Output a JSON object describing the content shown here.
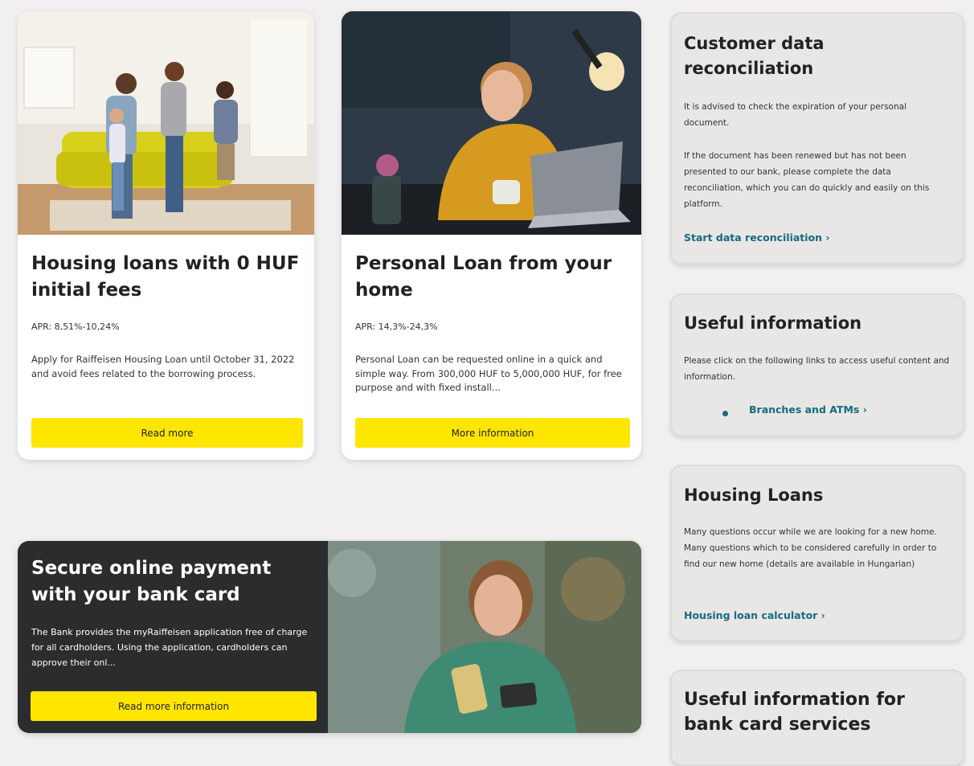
{
  "card_housing": {
    "title": "Housing loans with 0 HUF initial fees",
    "apr": "APR: 8,51%-10,24%",
    "description": "Apply for Raiffeisen Housing Loan until October 31, 2022 and avoid fees related to the borrowing process.",
    "button": "Read more",
    "image_icon": "family-living-room-photo"
  },
  "card_personal": {
    "title": "Personal Loan from your home",
    "apr": "APR: 14,3%-24,3%",
    "description": "Personal Loan can be requested online in a quick and simple way. From 300,000 HUF to 5,000,000 HUF, for free purpose and with fixed install...",
    "button": "More information",
    "image_icon": "woman-laptop-photo"
  },
  "promo_card": {
    "title": "Secure online payment with your bank card",
    "description": "The Bank provides the myRaiffeisen application free of charge for all cardholders. Using the application, cardholders can approve their onl...",
    "button": "Read more information",
    "image_icon": "woman-phone-card-photo"
  },
  "sidebar": {
    "customer_data": {
      "title": "Customer data reconciliation",
      "text1": "It is advised to check the expiration of your personal document.",
      "text2": "If the document has been renewed but has not been presented to our bank, please complete the data reconciliation, which you can do quickly and easily on this platform.",
      "link": "Start data reconciliation ›"
    },
    "useful_info": {
      "title": "Useful information",
      "text": "Please click on the following links to access useful content and information.",
      "link": "Branches and ATMs ›"
    },
    "housing_loans": {
      "title": "Housing Loans",
      "text": "Many questions occur while we are looking for a new home. Many questions which to be considered carefully in order to find our new home (details are available in Hungarian)",
      "link": "Housing loan calculator ›"
    },
    "bank_card": {
      "title": "Useful information for bank card services"
    }
  },
  "colors": {
    "accent_yellow": "#fee600",
    "link_teal": "#166a80",
    "dark_card": "#2b2c2e",
    "page_bg": "#f1efef"
  }
}
